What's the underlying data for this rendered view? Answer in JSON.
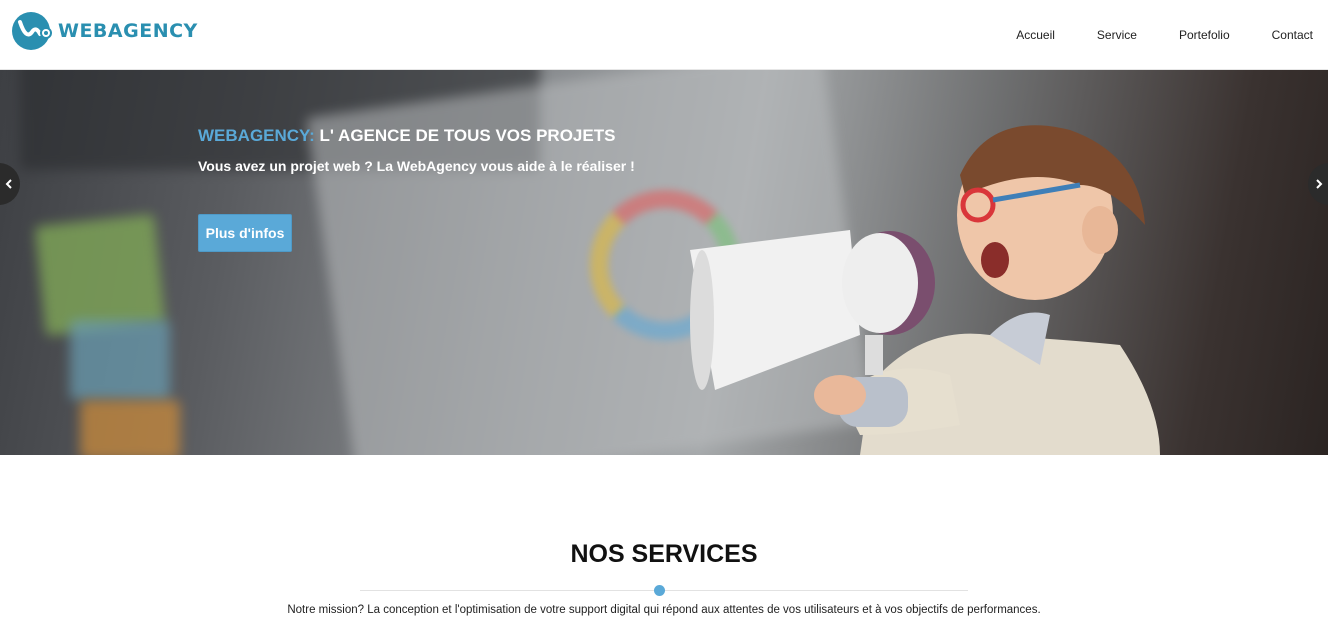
{
  "brand": {
    "name": "WEBAGENCY",
    "color": "#2a8fb0"
  },
  "nav": {
    "items": [
      "Accueil",
      "Service",
      "Portefolio",
      "Contact"
    ]
  },
  "hero": {
    "title_brand": "WEBAGENCY:",
    "title_rest": " L' AGENCE DE TOUS VOS PROJETS",
    "subtitle": "Vous avez un projet web ? La WebAgency vous aide à le réaliser !",
    "button_label": "Plus d'infos",
    "accent": "#5aa9d8",
    "prev_icon": "chevron-left-icon",
    "next_icon": "chevron-right-icon"
  },
  "services": {
    "title": "NOS SERVICES",
    "description": "Notre mission? La conception et l'optimisation de votre support digital qui répond aux attentes de vos utilisateurs et à vos objectifs de performances."
  }
}
